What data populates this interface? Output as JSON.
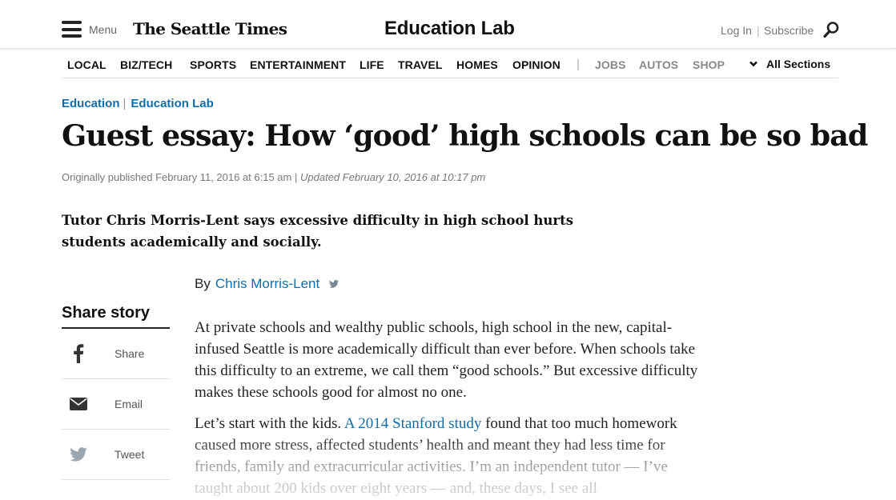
{
  "header": {
    "menu_label": "Menu",
    "logo_text": "The Seattle Times",
    "section_title": "Education Lab",
    "login_label": "Log In",
    "separator": "|",
    "subscribe_label": "Subscribe"
  },
  "nav": {
    "items": [
      "LOCAL",
      "BIZ/TECH",
      "SPORTS",
      "ENTERTAINMENT",
      "LIFE",
      "TRAVEL",
      "HOMES",
      "OPINION"
    ],
    "secondary": [
      "JOBS",
      "AUTOS",
      "SHOP"
    ],
    "all_sections": "All Sections"
  },
  "breadcrumb": [
    "Education",
    "Education Lab"
  ],
  "article": {
    "headline": "Guest essay: How ‘good’ high schools can be so bad",
    "published": "Originally published February 11, 2016 at 6:15 am",
    "updated": "Updated February 10, 2016 at 10:17 pm",
    "dek": "Tutor Chris Morris-Lent says excessive difficulty in high school hurts students academically and socially.",
    "by_label": "By",
    "author": "Chris Morris-Lent",
    "para1": "At private schools and wealthy public schools, high school in the new, capital-infused Seattle is more academically difficult than ever before. When schools take this difficulty to an extreme, we call them “good schools.” But excessive difficulty makes these schools good for almost no one.",
    "para2_before": "Let’s start with the kids. ",
    "para2_link": "A 2014 Stanford study",
    "para2_after": " found that too much homework caused more stress, affected students’ health and meant they had less time for friends, family and extracurricular activities. I’m an independent tutor — I’ve taught about 200 kids over eight years — and, these days, I see all"
  },
  "share": {
    "title": "Share story",
    "facebook": "Share",
    "email": "Email",
    "twitter": "Tweet"
  },
  "colors": {
    "link": "#0f6ea8",
    "text": "#222222"
  }
}
